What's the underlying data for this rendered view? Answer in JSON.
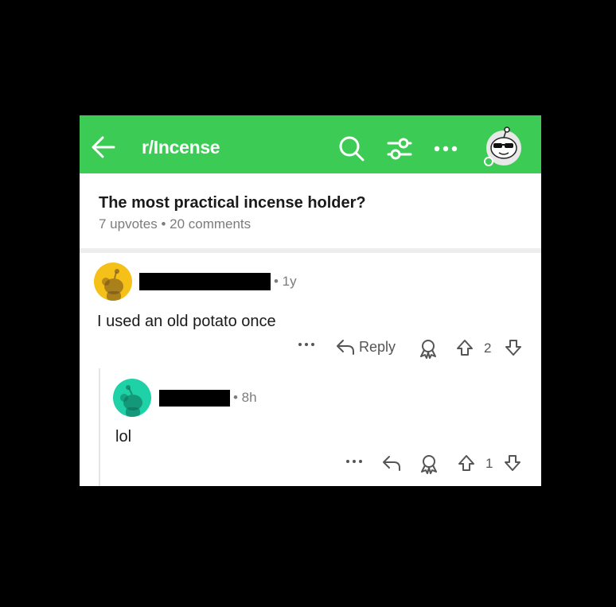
{
  "header": {
    "subreddit": "r/Incense"
  },
  "post": {
    "title": "The most practical incense holder?",
    "meta": "7 upvotes • 20 comments"
  },
  "comments": [
    {
      "time": "• 1y",
      "body": "I used an old potato once",
      "reply_label": "Reply",
      "votes": "2",
      "avatar_color": "#f5c018"
    },
    {
      "time": "• 8h",
      "body": "lol",
      "votes": "1",
      "avatar_color": "#1fd1a6"
    }
  ],
  "colors": {
    "topbar": "#3ccc55",
    "background": "#000000"
  },
  "icons": {
    "back": "arrow-left-icon",
    "search": "search-icon",
    "filter": "sort-filter-icon",
    "more": "more-dots-icon",
    "reply": "reply-arrow-icon",
    "award": "award-icon",
    "upvote": "upvote-icon",
    "downvote": "downvote-icon"
  }
}
